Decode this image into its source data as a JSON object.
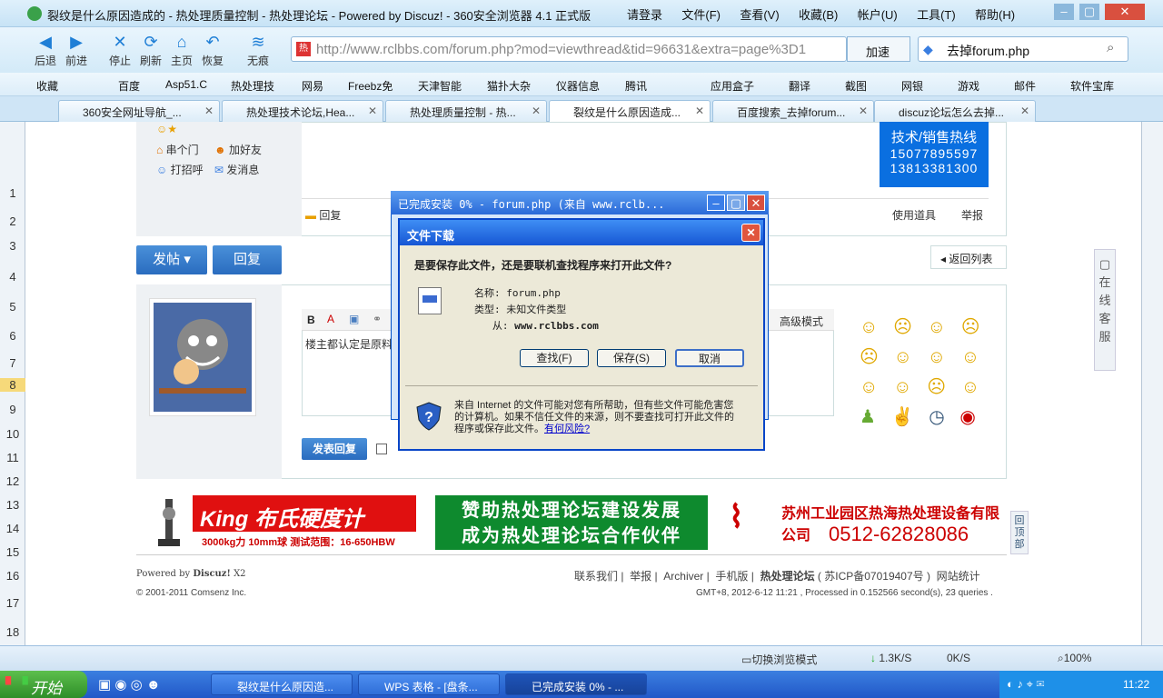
{
  "browser": {
    "title": "裂纹是什么原因造成的 - 热处理质量控制 - 热处理论坛 - Powered by Discuz! - 360安全浏览器 4.1 正式版",
    "menu": [
      "请登录",
      "文件(F)",
      "查看(V)",
      "收藏(B)",
      "帐户(U)",
      "工具(T)",
      "帮助(H)"
    ],
    "nav": [
      "后退",
      "前进",
      "停止",
      "刷新",
      "主页",
      "恢复",
      "无痕"
    ],
    "url": "http://www.rclbbs.com/forum.php?mod=viewthread&tid=96631&extra=page%3D1",
    "accelerate": "加速",
    "search_text": "去掉forum.php",
    "bookmarks": [
      "收藏",
      "百度",
      "Asp51.C",
      "热处理技",
      "网易",
      "Freebz免",
      "天津智能",
      "猫扑大杂",
      "仪器信息",
      "腾讯",
      "应用盒子",
      "翻译",
      "截图",
      "网银",
      "游戏",
      "邮件",
      "软件宝库"
    ],
    "tabs": [
      "360安全网址导航_...",
      "热处理技术论坛,Hea...",
      "热处理质量控制 - 热...",
      "裂纹是什么原因造成...",
      "百度搜索_去掉forum...",
      "discuz论坛怎么去掉..."
    ]
  },
  "sheet_rows": [
    "1",
    "2",
    "3",
    "4",
    "5",
    "6",
    "7",
    "8",
    "9",
    "10",
    "11",
    "12",
    "13",
    "14",
    "15",
    "16",
    "17",
    "18"
  ],
  "forum": {
    "user_links": [
      "串个门",
      "加好友",
      "打招呼",
      "发消息"
    ],
    "hotline_title": "技术/销售热线",
    "hotline_1": "15077895597",
    "hotline_2": "13813381300",
    "reply_link": "回复",
    "tools": "使用道具",
    "report": "举报",
    "post_btn": "发帖",
    "reply_btn": "回复",
    "back_list": "返回列表",
    "editor_mode": "高级模式",
    "editor_text": "楼主都认定是原料",
    "submit_btn": "发表回复",
    "online_service": "在线客服",
    "back_top": "回顶部",
    "ad1_title": "King 布氏硬度计",
    "ad1_sub": "3000kg力  10mm球  测试范围：16-650HBW",
    "ad2_line1": "赞助热处理论坛建设发展",
    "ad2_line2": "成为热处理论坛合作伙伴",
    "ad3_title": "苏州工业园区热海热处理设备有限公司",
    "ad3_phone": "0512-62828086",
    "powered": "Powered by",
    "powered_brand": "Discuz!",
    "powered_ver": "X2",
    "copyright": "© 2001-2011 Comsenz Inc.",
    "footer_links": [
      "联系我们",
      "举报",
      "Archiver",
      "手机版",
      "热处理论坛",
      "( 苏ICP备07019407号 )",
      "网站统计"
    ],
    "footer_stats": "GMT+8, 2012-6-12 11:21 , Processed in 0.152566 second(s), 23 queries ."
  },
  "progress_dialog": {
    "title": "已完成安装 0% - forum.php (来自 www.rclb..."
  },
  "download_dialog": {
    "title": "文件下载",
    "question": "是要保存此文件，还是要联机查找程序来打开此文件?",
    "name_label": "名称:",
    "name_value": "forum.php",
    "type_label": "类型:",
    "type_value": "未知文件类型",
    "from_label": "从:",
    "from_value": "www.rclbbs.com",
    "btn_find": "查找(F)",
    "btn_save": "保存(S)",
    "btn_cancel": "取消",
    "warning": "来自 Internet 的文件可能对您有所帮助，但有些文件可能危害您的计算机。如果不信任文件的来源，则不要查找可打开此文件的程序或保存此文件。",
    "risk_link": "有何风险?"
  },
  "statusbar": {
    "switch_mode": "切换浏览模式",
    "down_speed": "1.3K/S",
    "up_speed": "0K/S",
    "zoom": "100%"
  },
  "taskbar": {
    "start": "开始",
    "tasks": [
      "裂纹是什么原因造...",
      "WPS 表格 - [盘条...",
      "已完成安装 0% - ..."
    ],
    "clock": "11:22"
  }
}
